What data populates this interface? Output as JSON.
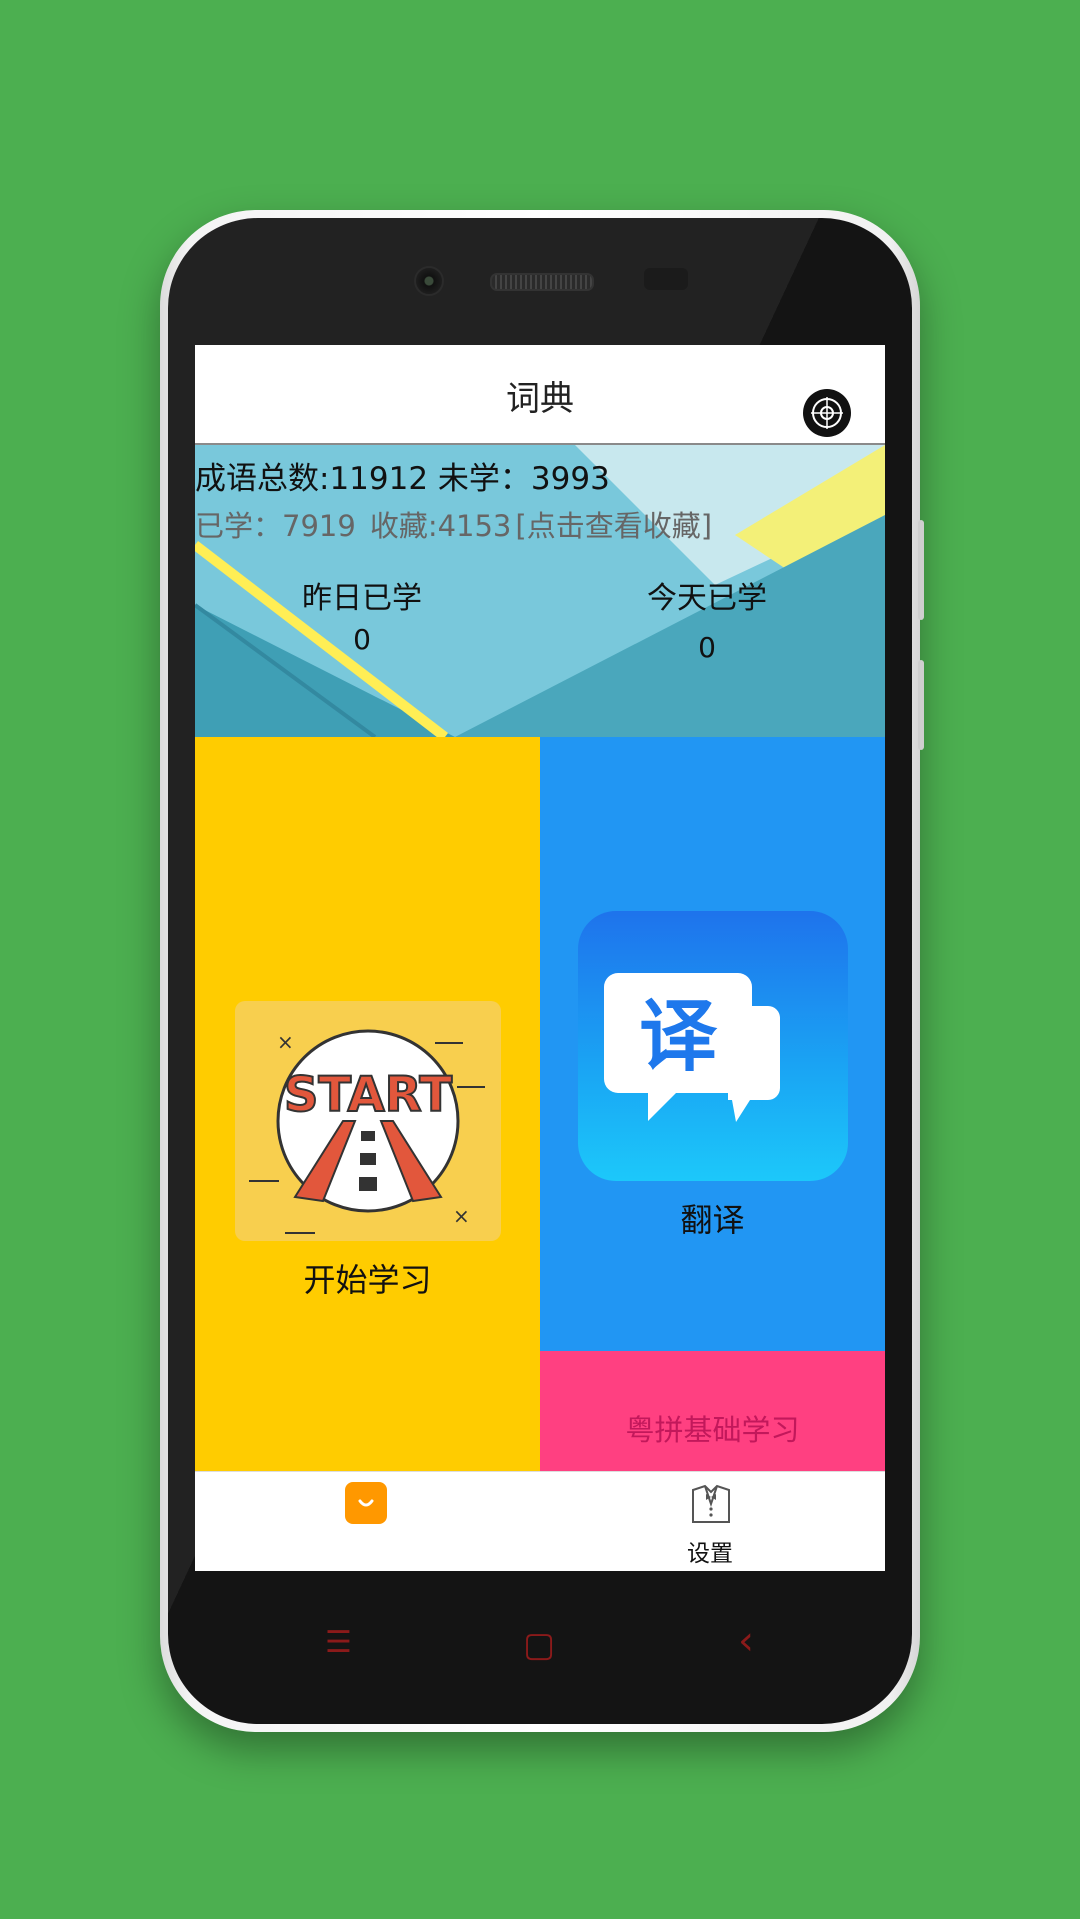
{
  "header": {
    "title": "词典",
    "menu_icon": "gear-circle-icon"
  },
  "stats": {
    "total_label": "成语总数:11912",
    "unlearned_label": "未学：3993",
    "learned_label": "已学：7919",
    "favorites_label": "收藏:4153",
    "view_favorites_link": "[点击查看收藏]"
  },
  "daily": {
    "yesterday_label": "昨日已学",
    "yesterday_count": "0",
    "today_label": "今天已学",
    "today_count": "0"
  },
  "tiles": {
    "start": {
      "label": "开始学习",
      "icon": "start-road-icon",
      "icon_text": "START",
      "color": "#ffcc00"
    },
    "translate": {
      "label": "翻译",
      "icon": "translate-icon",
      "icon_text": "译",
      "color": "#2196f3"
    },
    "cantonese": {
      "label": "粤拼基础学习",
      "color": "#ff4081"
    }
  },
  "tabbar": {
    "home_icon": "shopping-bag-smile-icon",
    "settings_icon": "tuxedo-icon",
    "settings_label": "设置"
  },
  "navbar": {
    "menu": "☰",
    "home": "▢",
    "back": "‹"
  }
}
